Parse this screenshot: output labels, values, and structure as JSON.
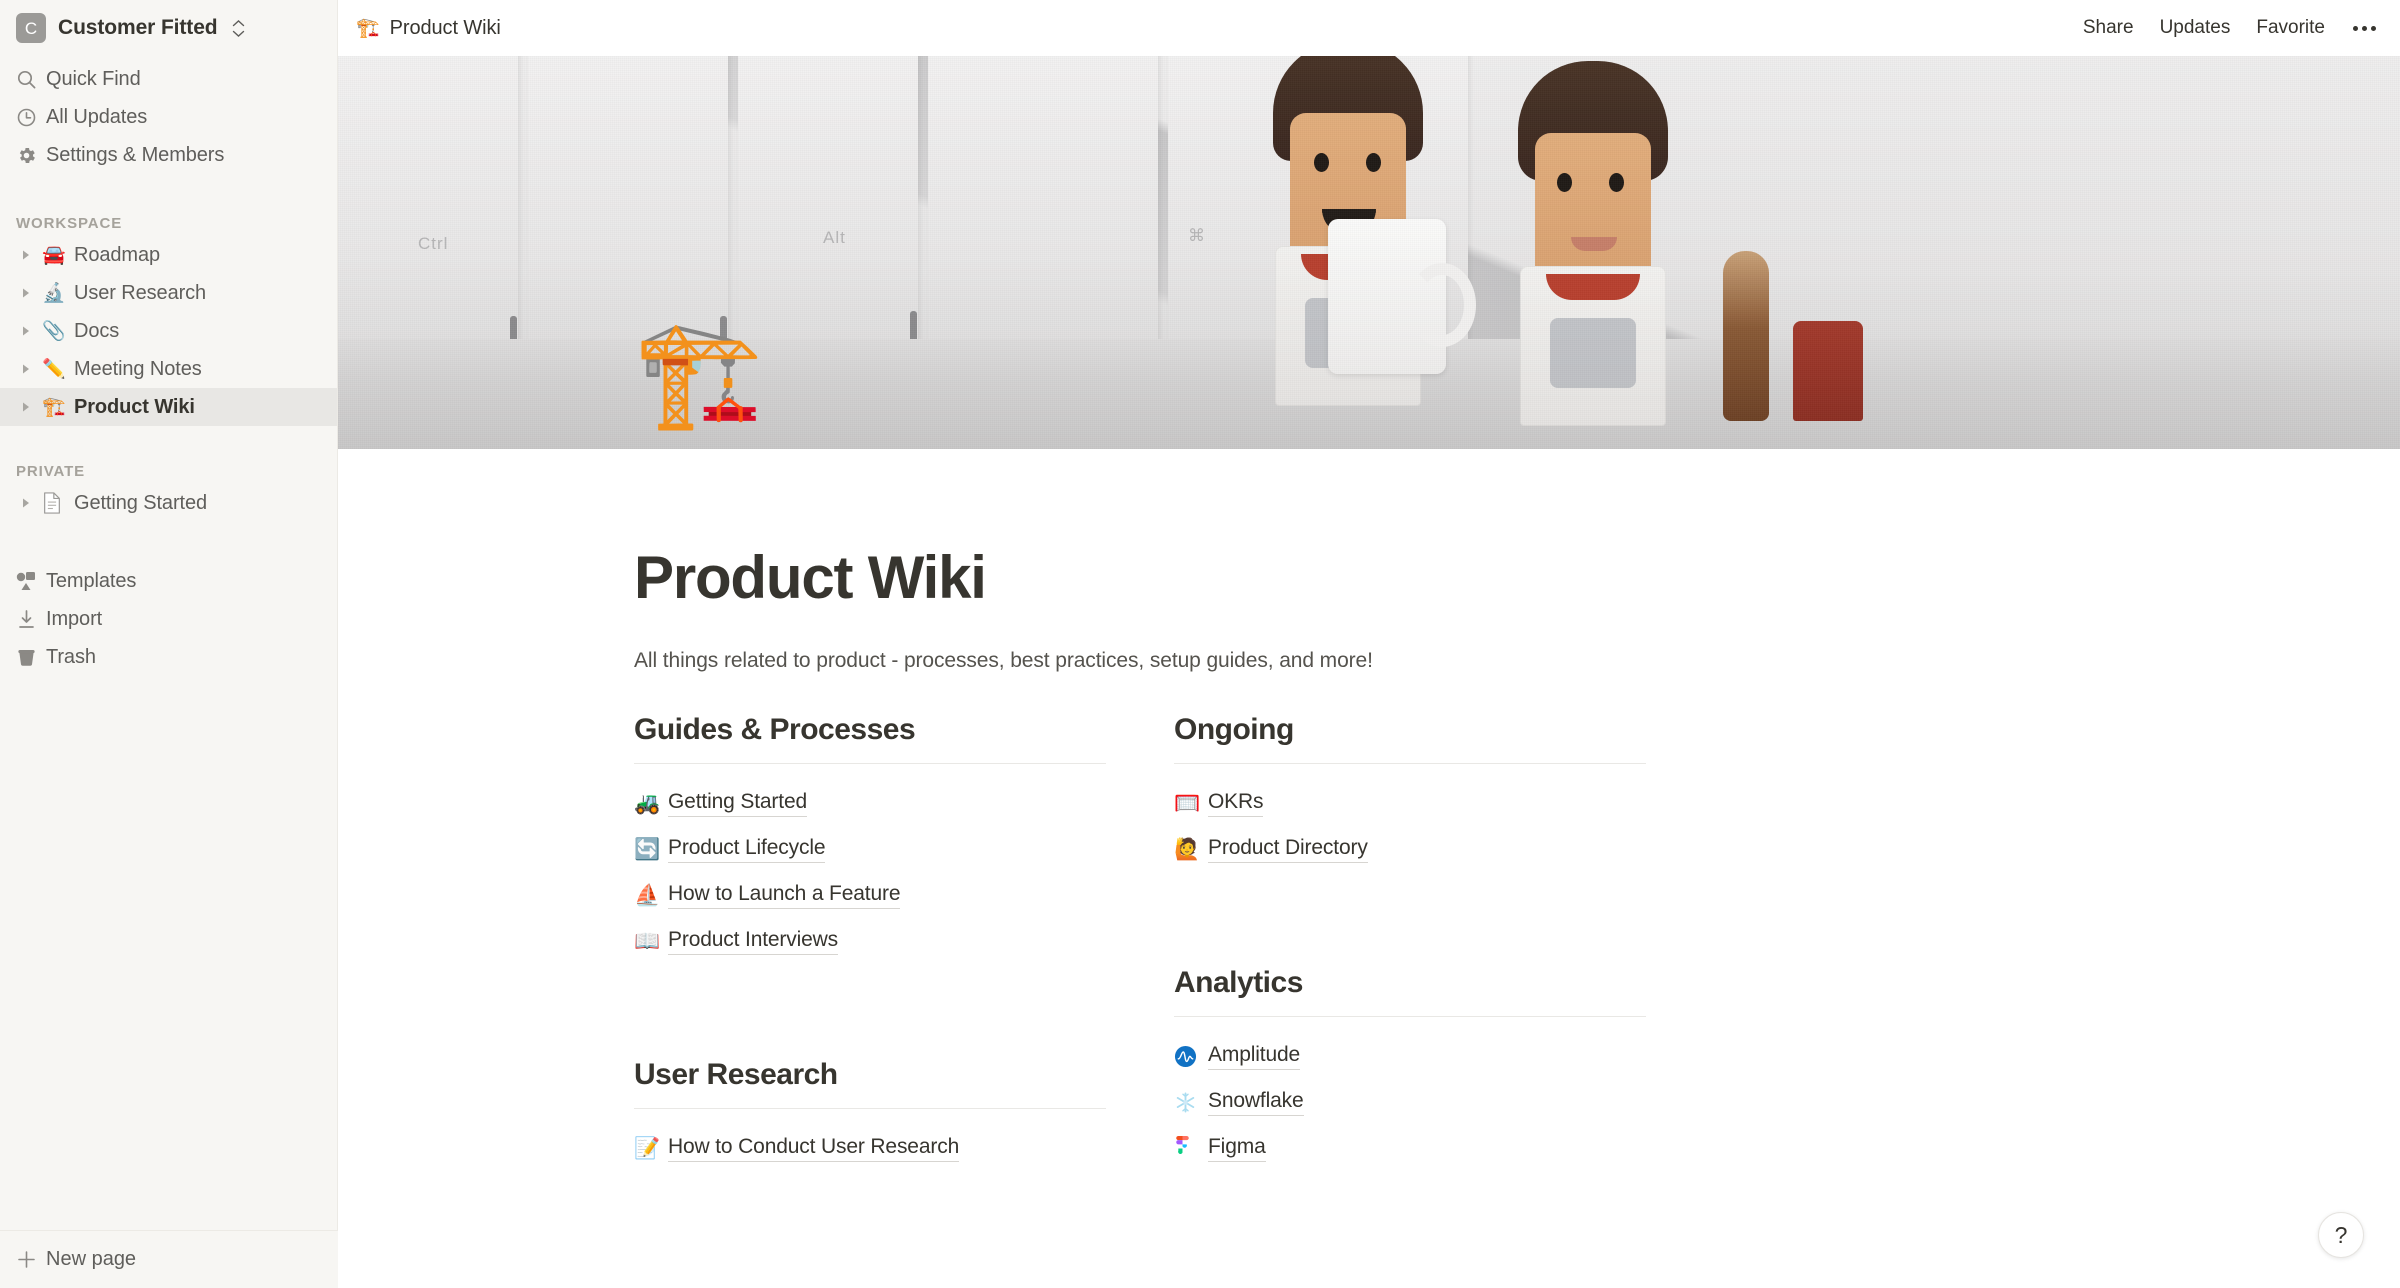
{
  "sidebar": {
    "workspace_name": "Customer Fitted",
    "workspace_badge": "C",
    "nav_top": [
      {
        "label": "Quick Find",
        "icon": "search-icon"
      },
      {
        "label": "All Updates",
        "icon": "clock-icon"
      },
      {
        "label": "Settings & Members",
        "icon": "gear-icon"
      }
    ],
    "workspace_section_title": "WORKSPACE",
    "workspace_items": [
      {
        "label": "Roadmap",
        "emoji": "🚘"
      },
      {
        "label": "User Research",
        "emoji": "🔬"
      },
      {
        "label": "Docs",
        "emoji": "📎"
      },
      {
        "label": "Meeting Notes",
        "emoji": "✏️"
      },
      {
        "label": "Product Wiki",
        "emoji": "🏗️",
        "active": true
      }
    ],
    "private_section_title": "PRIVATE",
    "private_items": [
      {
        "label": "Getting Started",
        "emoji": "📄"
      }
    ],
    "nav_bottom": [
      {
        "label": "Templates",
        "icon": "templates-icon"
      },
      {
        "label": "Import",
        "icon": "import-icon"
      },
      {
        "label": "Trash",
        "icon": "trash-icon"
      }
    ],
    "new_page_label": "New page"
  },
  "topbar": {
    "breadcrumb_emoji": "🏗️",
    "breadcrumb_label": "Product Wiki",
    "actions": [
      "Share",
      "Updates",
      "Favorite"
    ],
    "more_icon": "more-horizontal-icon"
  },
  "page": {
    "icon_emoji": "🏗️",
    "title": "Product Wiki",
    "description": "All things related to product - processes, best practices, setup guides, and more!",
    "cover_alt": "lego-astronauts-on-keyboard-cover"
  },
  "sections": [
    {
      "heading": "Guides & Processes",
      "column": "left",
      "links": [
        {
          "label": "Getting Started",
          "emoji": "🚜"
        },
        {
          "label": "Product Lifecycle",
          "emoji": "🔄"
        },
        {
          "label": "How to Launch a Feature",
          "emoji": "⛵"
        },
        {
          "label": "Product Interviews",
          "emoji": "📖"
        }
      ]
    },
    {
      "heading": "Ongoing",
      "column": "right",
      "links": [
        {
          "label": "OKRs",
          "emoji": "🥅"
        },
        {
          "label": "Product Directory",
          "emoji": "🙋"
        }
      ]
    },
    {
      "heading": "User Research",
      "column": "left",
      "links": [
        {
          "label": "How to Conduct User Research",
          "emoji": "📝"
        }
      ]
    },
    {
      "heading": "Analytics",
      "column": "right",
      "links": [
        {
          "label": "Amplitude",
          "brand": "amplitude-icon"
        },
        {
          "label": "Snowflake",
          "brand": "snowflake-icon"
        },
        {
          "label": "Figma",
          "brand": "figma-icon"
        }
      ]
    }
  ],
  "help_button": {
    "label": "?"
  },
  "colors": {
    "sidebar_bg": "#f7f6f3",
    "text_primary": "#37352f",
    "text_secondary": "#5f5e5b",
    "active_row": "#e8e7e4",
    "amplitude_blue": "#1172c4",
    "snowflake_blue": "#a9dcf0",
    "figma_red": "#f24e1e"
  }
}
